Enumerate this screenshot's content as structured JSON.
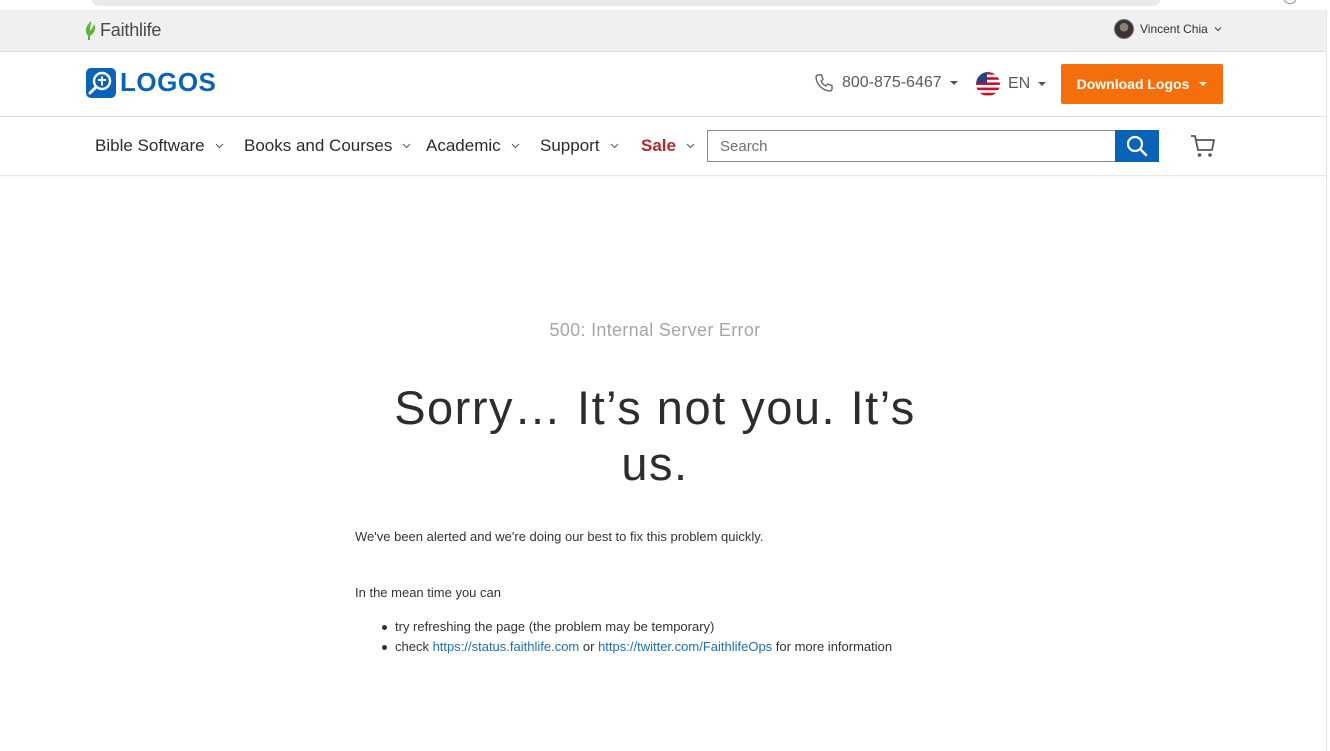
{
  "faithlife_bar": {
    "brand": "Faithlife",
    "user_name": "Vincent Chia"
  },
  "header": {
    "brand": "LOGOS",
    "phone": "800-875-6467",
    "language": "EN",
    "download_label": "Download Logos",
    "accent_color": "#f46f0b",
    "brand_color": "#0a63b7"
  },
  "nav": {
    "items": [
      {
        "label": "Bible Software"
      },
      {
        "label": "Books and Courses"
      },
      {
        "label": "Academic"
      },
      {
        "label": "Support"
      },
      {
        "label": "Sale"
      }
    ],
    "search_placeholder": "Search"
  },
  "main": {
    "error_code": "500: Internal Server Error",
    "headline": "Sorry… It’s not you. It’s us.",
    "message": "We've been alerted and we're doing our best to fix this problem quickly.",
    "meantime": "In the mean time you can",
    "tip1": "try refreshing the page (the problem may be temporary)",
    "tip2_prefix": "check ",
    "tip2_link1": "https://status.faithlife.com",
    "tip2_mid": " or ",
    "tip2_link2": "https://twitter.com/FaithlifeOps",
    "tip2_suffix": " for more information"
  }
}
